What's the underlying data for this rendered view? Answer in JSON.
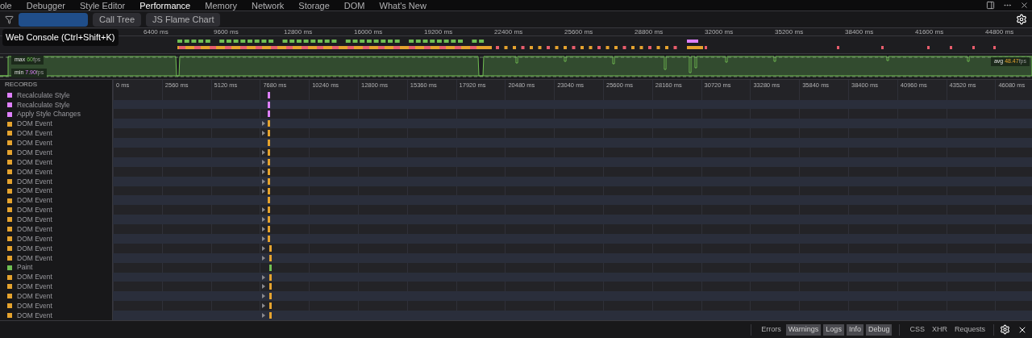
{
  "toolbar": {
    "tabs": [
      {
        "label": "ole",
        "selected": false
      },
      {
        "label": "Debugger",
        "selected": false
      },
      {
        "label": "Style Editor",
        "selected": false
      },
      {
        "label": "Performance",
        "selected": true
      },
      {
        "label": "Memory",
        "selected": false
      },
      {
        "label": "Network",
        "selected": false
      },
      {
        "label": "Storage",
        "selected": false
      },
      {
        "label": "DOM",
        "selected": false
      },
      {
        "label": "What's New",
        "selected": false
      }
    ]
  },
  "view_tabs": [
    {
      "selected": true
    },
    {
      "label": "Call Tree",
      "selected": false
    },
    {
      "label": "JS Flame Chart",
      "selected": false
    }
  ],
  "tooltip": "Web Console (Ctrl+Shift+K)",
  "overview": {
    "ticks": [
      "6400 ms",
      "9600 ms",
      "12800 ms",
      "16000 ms",
      "19200 ms",
      "22400 ms",
      "25600 ms",
      "28800 ms",
      "32000 ms",
      "35200 ms",
      "38400 ms",
      "41600 ms",
      "44800 ms"
    ],
    "fps": {
      "max_label": "max",
      "max": "60",
      "min_label": "min",
      "min": "7.90",
      "max_unit": "fps",
      "min_unit": "fps",
      "avg_label": "avg",
      "avg": "48.47",
      "avg_unit": "fps"
    }
  },
  "waterfall": {
    "header": "RECORDS",
    "ticks": [
      "0 ms",
      "2560 ms",
      "5120 ms",
      "7680 ms",
      "10240 ms",
      "12800 ms",
      "15360 ms",
      "17920 ms",
      "20480 ms",
      "23040 ms",
      "25600 ms",
      "28160 ms",
      "30720 ms",
      "33280 ms",
      "35840 ms",
      "38400 ms",
      "40960 ms",
      "43520 ms",
      "46080 ms"
    ],
    "rows": [
      {
        "name": "Recalculate Style",
        "color": "#df80ff",
        "expandable": false
      },
      {
        "name": "Recalculate Style",
        "color": "#df80ff",
        "expandable": false
      },
      {
        "name": "Apply Style Changes",
        "color": "#df80ff",
        "expandable": false
      },
      {
        "name": "DOM Event",
        "color": "#e5a32e",
        "expandable": true
      },
      {
        "name": "DOM Event",
        "color": "#e5a32e",
        "expandable": true
      },
      {
        "name": "DOM Event",
        "color": "#e5a32e",
        "expandable": false
      },
      {
        "name": "DOM Event",
        "color": "#e5a32e",
        "expandable": true
      },
      {
        "name": "DOM Event",
        "color": "#e5a32e",
        "expandable": true
      },
      {
        "name": "DOM Event",
        "color": "#e5a32e",
        "expandable": true
      },
      {
        "name": "DOM Event",
        "color": "#e5a32e",
        "expandable": true
      },
      {
        "name": "DOM Event",
        "color": "#e5a32e",
        "expandable": true
      },
      {
        "name": "DOM Event",
        "color": "#e5a32e",
        "expandable": false
      },
      {
        "name": "DOM Event",
        "color": "#e5a32e",
        "expandable": true
      },
      {
        "name": "DOM Event",
        "color": "#e5a32e",
        "expandable": true
      },
      {
        "name": "DOM Event",
        "color": "#e5a32e",
        "expandable": true
      },
      {
        "name": "DOM Event",
        "color": "#e5a32e",
        "expandable": true
      },
      {
        "name": "DOM Event",
        "color": "#e5a32e",
        "expandable": true
      },
      {
        "name": "DOM Event",
        "color": "#e5a32e",
        "expandable": true
      },
      {
        "name": "Paint",
        "color": "#70bf53",
        "expandable": false
      },
      {
        "name": "DOM Event",
        "color": "#e5a32e",
        "expandable": true
      },
      {
        "name": "DOM Event",
        "color": "#e5a32e",
        "expandable": true
      },
      {
        "name": "DOM Event",
        "color": "#e5a32e",
        "expandable": true
      },
      {
        "name": "DOM Event",
        "color": "#e5a32e",
        "expandable": true
      },
      {
        "name": "DOM Event",
        "color": "#e5a32e",
        "expandable": true
      }
    ]
  },
  "console_filters": [
    {
      "label": "Errors",
      "selected": false
    },
    {
      "label": "Warnings",
      "selected": true
    },
    {
      "label": "Logs",
      "selected": true
    },
    {
      "label": "Info",
      "selected": true
    },
    {
      "label": "Debug",
      "selected": true
    }
  ],
  "console_filters_2": [
    {
      "label": "CSS",
      "selected": false
    },
    {
      "label": "XHR",
      "selected": false
    },
    {
      "label": "Requests",
      "selected": false
    }
  ]
}
